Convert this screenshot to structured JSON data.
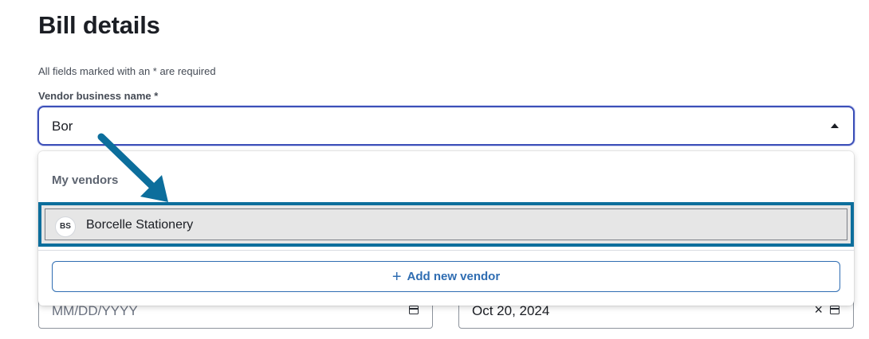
{
  "page": {
    "title": "Bill details",
    "required_note": "All fields marked with an * are required"
  },
  "vendor_field": {
    "label": "Vendor business name *",
    "value": "Bor"
  },
  "dropdown": {
    "group_label": "My vendors",
    "options": [
      {
        "initials": "BS",
        "label": "Borcelle Stationery",
        "highlighted": true
      }
    ],
    "add_button_label": "Add new vendor"
  },
  "date_fields": {
    "left_placeholder": "MM/DD/YYYY",
    "right_value": "Oct 20, 2024"
  },
  "colors": {
    "focus_border": "#3c4fb8",
    "highlight_border": "#0c6e9c",
    "link_blue": "#2f6db2",
    "annotation_arrow": "#0c6e9c"
  },
  "icons": {
    "dropdown_toggle": "caret-up-icon",
    "add": "plus-icon",
    "calendar": "calendar-icon",
    "clear": "close-icon"
  }
}
